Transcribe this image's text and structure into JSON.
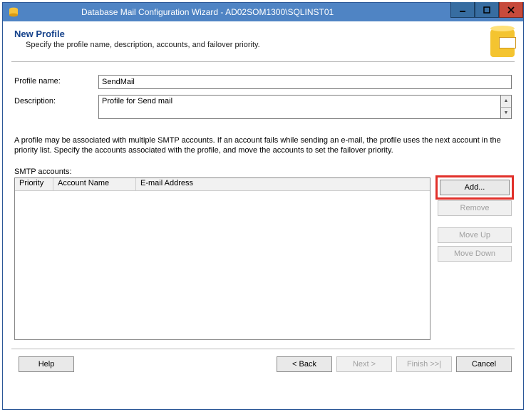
{
  "titlebar": {
    "title": "Database Mail Configuration Wizard - AD02SOM1300\\SQLINST01"
  },
  "header": {
    "title": "New Profile",
    "subtitle": "Specify the profile name, description, accounts, and failover priority."
  },
  "form": {
    "profile_name_label": "Profile name:",
    "profile_name_value": "SendMail",
    "description_label": "Description:",
    "description_value": "Profile for Send mail"
  },
  "info_text": "A profile may be associated with multiple SMTP accounts. If an account fails while sending an e-mail, the profile uses the next account in the priority list. Specify the accounts associated with the profile, and move the accounts to set the failover priority.",
  "smtp": {
    "label": "SMTP accounts:",
    "columns": {
      "priority": "Priority",
      "account_name": "Account Name",
      "email": "E-mail Address"
    },
    "rows": []
  },
  "side_buttons": {
    "add": "Add...",
    "remove": "Remove",
    "move_up": "Move Up",
    "move_down": "Move Down"
  },
  "footer": {
    "help": "Help",
    "back": "< Back",
    "next": "Next >",
    "finish": "Finish >>|",
    "cancel": "Cancel"
  }
}
